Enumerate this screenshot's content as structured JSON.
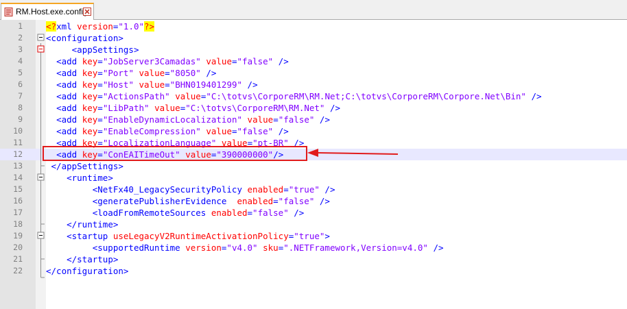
{
  "tab": {
    "title": "RM.Host.exe.config"
  },
  "lines": [
    {
      "n": "1",
      "indent": "",
      "parts": [
        [
          "pi",
          "<?"
        ],
        [
          "tag",
          "xml "
        ],
        [
          "attr",
          "version"
        ],
        [
          "tag",
          "="
        ],
        [
          "val",
          "\"1.0\""
        ],
        [
          "pi",
          "?>"
        ]
      ]
    },
    {
      "n": "2",
      "indent": "",
      "parts": [
        [
          "tag",
          "<configuration>"
        ]
      ]
    },
    {
      "n": "3",
      "indent": "     ",
      "parts": [
        [
          "tag",
          "<appSettings>"
        ]
      ]
    },
    {
      "n": "4",
      "indent": "  ",
      "parts": [
        [
          "tag",
          "<add "
        ],
        [
          "attr",
          "key"
        ],
        [
          "tag",
          "="
        ],
        [
          "val",
          "\"JobServer3Camadas\""
        ],
        [
          "tag",
          " "
        ],
        [
          "attr",
          "value"
        ],
        [
          "tag",
          "="
        ],
        [
          "val",
          "\"false\""
        ],
        [
          "tag",
          " />"
        ]
      ]
    },
    {
      "n": "5",
      "indent": "  ",
      "parts": [
        [
          "tag",
          "<add "
        ],
        [
          "attr",
          "key"
        ],
        [
          "tag",
          "="
        ],
        [
          "val",
          "\"Port\""
        ],
        [
          "tag",
          " "
        ],
        [
          "attr",
          "value"
        ],
        [
          "tag",
          "="
        ],
        [
          "val",
          "\"8050\""
        ],
        [
          "tag",
          " />"
        ]
      ]
    },
    {
      "n": "6",
      "indent": "  ",
      "parts": [
        [
          "tag",
          "<add "
        ],
        [
          "attr",
          "key"
        ],
        [
          "tag",
          "="
        ],
        [
          "val",
          "\"Host\""
        ],
        [
          "tag",
          " "
        ],
        [
          "attr",
          "value"
        ],
        [
          "tag",
          "="
        ],
        [
          "val",
          "\"BHN019401299\""
        ],
        [
          "tag",
          " />"
        ]
      ]
    },
    {
      "n": "7",
      "indent": "  ",
      "parts": [
        [
          "tag",
          "<add "
        ],
        [
          "attr",
          "key"
        ],
        [
          "tag",
          "="
        ],
        [
          "val",
          "\"ActionsPath\""
        ],
        [
          "tag",
          " "
        ],
        [
          "attr",
          "value"
        ],
        [
          "tag",
          "="
        ],
        [
          "val",
          "\"C:\\totvs\\CorporeRM\\RM.Net;C:\\totvs\\CorporeRM\\Corpore.Net\\Bin\""
        ],
        [
          "tag",
          " />"
        ]
      ]
    },
    {
      "n": "8",
      "indent": "  ",
      "parts": [
        [
          "tag",
          "<add "
        ],
        [
          "attr",
          "key"
        ],
        [
          "tag",
          "="
        ],
        [
          "val",
          "\"LibPath\""
        ],
        [
          "tag",
          " "
        ],
        [
          "attr",
          "value"
        ],
        [
          "tag",
          "="
        ],
        [
          "val",
          "\"C:\\totvs\\CorporeRM\\RM.Net\""
        ],
        [
          "tag",
          " />"
        ]
      ]
    },
    {
      "n": "9",
      "indent": "  ",
      "parts": [
        [
          "tag",
          "<add "
        ],
        [
          "attr",
          "key"
        ],
        [
          "tag",
          "="
        ],
        [
          "val",
          "\"EnableDynamicLocalization\""
        ],
        [
          "tag",
          " "
        ],
        [
          "attr",
          "value"
        ],
        [
          "tag",
          "="
        ],
        [
          "val",
          "\"false\""
        ],
        [
          "tag",
          " />"
        ]
      ]
    },
    {
      "n": "10",
      "indent": "  ",
      "parts": [
        [
          "tag",
          "<add "
        ],
        [
          "attr",
          "key"
        ],
        [
          "tag",
          "="
        ],
        [
          "val",
          "\"EnableCompression\""
        ],
        [
          "tag",
          " "
        ],
        [
          "attr",
          "value"
        ],
        [
          "tag",
          "="
        ],
        [
          "val",
          "\"false\""
        ],
        [
          "tag",
          " />"
        ]
      ]
    },
    {
      "n": "11",
      "indent": "  ",
      "parts": [
        [
          "tag",
          "<add "
        ],
        [
          "attr",
          "key"
        ],
        [
          "tag",
          "="
        ],
        [
          "val",
          "\"LocalizationLanguage\""
        ],
        [
          "tag",
          " "
        ],
        [
          "attr",
          "value"
        ],
        [
          "tag",
          "="
        ],
        [
          "val",
          "\"pt-BR\""
        ],
        [
          "tag",
          " />"
        ]
      ]
    },
    {
      "n": "12",
      "indent": "  ",
      "parts": [
        [
          "tag",
          "<add "
        ],
        [
          "attr",
          "key"
        ],
        [
          "tag",
          "="
        ],
        [
          "val",
          "\"ConEAITimeOut\""
        ],
        [
          "tag",
          " "
        ],
        [
          "attr",
          "value"
        ],
        [
          "tag",
          "="
        ],
        [
          "val",
          "\"390000000\""
        ],
        [
          "tag",
          "/>"
        ]
      ]
    },
    {
      "n": "13",
      "indent": " ",
      "parts": [
        [
          "tag",
          "</appSettings>"
        ]
      ]
    },
    {
      "n": "14",
      "indent": "    ",
      "parts": [
        [
          "tag",
          "<runtime>"
        ]
      ]
    },
    {
      "n": "15",
      "indent": "         ",
      "parts": [
        [
          "tag",
          "<NetFx40_LegacySecurityPolicy "
        ],
        [
          "attr",
          "enabled"
        ],
        [
          "tag",
          "="
        ],
        [
          "val",
          "\"true\""
        ],
        [
          "tag",
          " />"
        ]
      ]
    },
    {
      "n": "16",
      "indent": "         ",
      "parts": [
        [
          "tag",
          "<generatePublisherEvidence  "
        ],
        [
          "attr",
          "enabled"
        ],
        [
          "tag",
          "="
        ],
        [
          "val",
          "\"false\""
        ],
        [
          "tag",
          " />"
        ]
      ]
    },
    {
      "n": "17",
      "indent": "         ",
      "parts": [
        [
          "tag",
          "<loadFromRemoteSources "
        ],
        [
          "attr",
          "enabled"
        ],
        [
          "tag",
          "="
        ],
        [
          "val",
          "\"false\""
        ],
        [
          "tag",
          " />"
        ]
      ]
    },
    {
      "n": "18",
      "indent": "    ",
      "parts": [
        [
          "tag",
          "</runtime>"
        ]
      ]
    },
    {
      "n": "19",
      "indent": "    ",
      "parts": [
        [
          "tag",
          "<startup "
        ],
        [
          "attr",
          "useLegacyV2RuntimeActivationPolicy"
        ],
        [
          "tag",
          "="
        ],
        [
          "val",
          "\"true\""
        ],
        [
          "tag",
          ">"
        ]
      ]
    },
    {
      "n": "20",
      "indent": "         ",
      "parts": [
        [
          "tag",
          "<supportedRuntime "
        ],
        [
          "attr",
          "version"
        ],
        [
          "tag",
          "="
        ],
        [
          "val",
          "\"v4.0\""
        ],
        [
          "tag",
          " "
        ],
        [
          "attr",
          "sku"
        ],
        [
          "tag",
          "="
        ],
        [
          "val",
          "\".NETFramework,Version=v4.0\""
        ],
        [
          "tag",
          " />"
        ]
      ]
    },
    {
      "n": "21",
      "indent": "    ",
      "parts": [
        [
          "tag",
          "</startup>"
        ]
      ]
    },
    {
      "n": "22",
      "indent": "",
      "parts": [
        [
          "tag",
          "</configuration>"
        ]
      ]
    }
  ],
  "highlighted_line": "12",
  "icons": {
    "file": "xml-file-icon",
    "close": "close-icon"
  },
  "colors": {
    "tag": "#0000ff",
    "attribute": "#ff0000",
    "value": "#8000ff",
    "callout": "#e11b1b",
    "highlight": "#e8e8ff"
  }
}
